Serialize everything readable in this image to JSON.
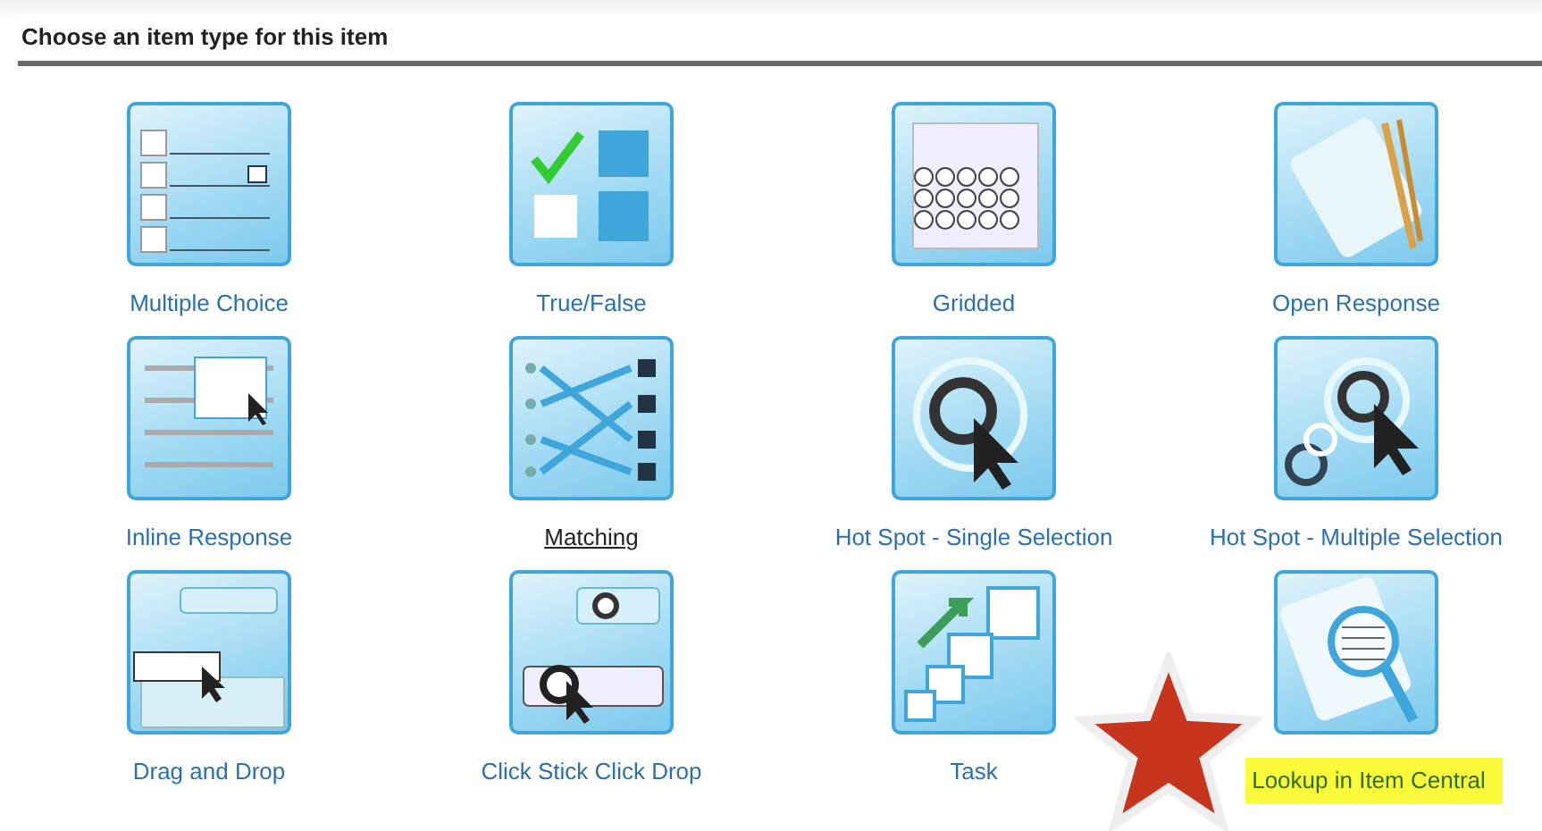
{
  "title": "Choose an item type for this item",
  "items": [
    {
      "label": "Multiple Choice",
      "kind": "choice",
      "hovered": false,
      "highlighted": false
    },
    {
      "label": "True/False",
      "kind": "truefalse",
      "hovered": false,
      "highlighted": false
    },
    {
      "label": "Gridded",
      "kind": "grid",
      "hovered": false,
      "highlighted": false
    },
    {
      "label": "Open Response",
      "kind": "open",
      "hovered": false,
      "highlighted": false
    },
    {
      "label": "Inline Response",
      "kind": "inline",
      "hovered": false,
      "highlighted": false
    },
    {
      "label": "Matching",
      "kind": "matching",
      "hovered": true,
      "highlighted": false
    },
    {
      "label": "Hot Spot - Single Selection",
      "kind": "hotspot",
      "hovered": false,
      "highlighted": false
    },
    {
      "label": "Hot Spot - Multiple Selection",
      "kind": "hotspots",
      "hovered": false,
      "highlighted": false
    },
    {
      "label": "Drag and Drop",
      "kind": "drag",
      "hovered": false,
      "highlighted": false
    },
    {
      "label": "Click Stick Click Drop",
      "kind": "click",
      "hovered": false,
      "highlighted": false
    },
    {
      "label": "Task",
      "kind": "task",
      "hovered": false,
      "highlighted": false
    },
    {
      "label": "Lookup in Item Central",
      "kind": "lookup",
      "hovered": false,
      "highlighted": true,
      "starred": true
    }
  ]
}
